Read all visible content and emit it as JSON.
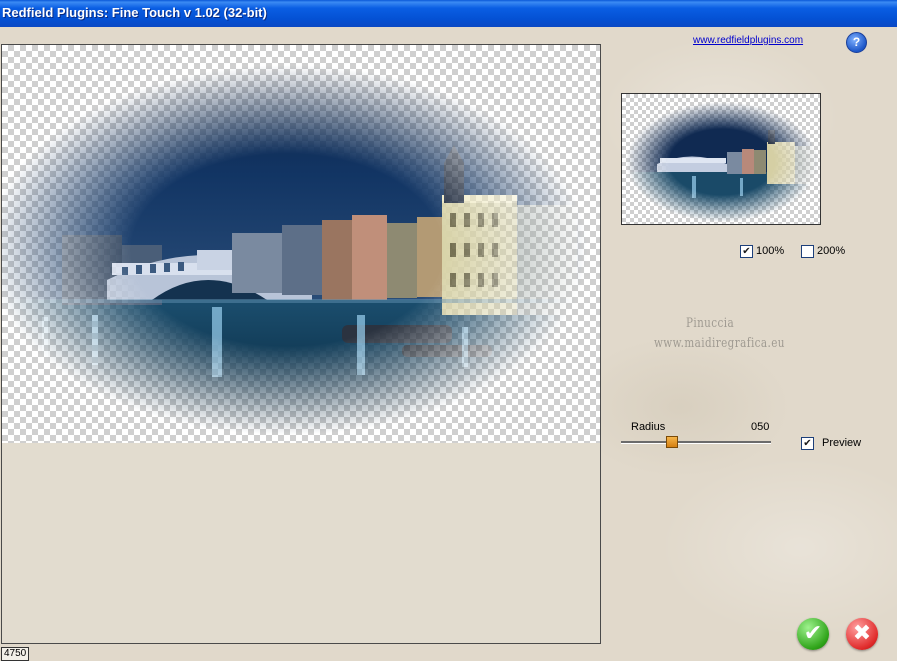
{
  "window": {
    "title": "Redfield Plugins: Fine Touch v 1.02 (32-bit)"
  },
  "header": {
    "link_text": "www.redfieldplugins.com",
    "help_glyph": "?"
  },
  "zoom": {
    "option_100": {
      "label": "100%",
      "checked": true
    },
    "option_200": {
      "label": "200%",
      "checked": false
    }
  },
  "watermark": {
    "line1": "Pinuccia",
    "line2": "www.maidiregrafica.eu"
  },
  "radius": {
    "label": "Radius",
    "value": "050",
    "level": 0.33
  },
  "preview": {
    "label": "Preview",
    "checked": true
  },
  "buttons": {
    "ok_glyph": "✔",
    "cancel_glyph": "✖"
  },
  "status": {
    "value": "4750"
  },
  "colors": {
    "titlebar": "#0a5ee3",
    "ok": "#2ea318",
    "cancel": "#e02a2a",
    "link": "#0000cc"
  }
}
